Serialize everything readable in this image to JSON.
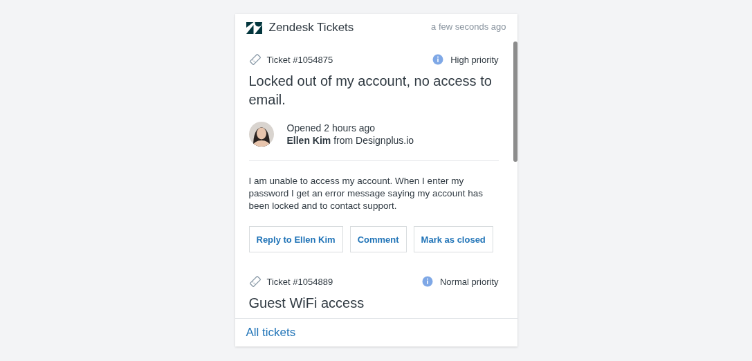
{
  "header": {
    "title": "Zendesk Tickets",
    "timestamp": "a few seconds ago"
  },
  "tickets": [
    {
      "number": "Ticket #1054875",
      "priority": "High priority",
      "title": "Locked out of my account, no access to email.",
      "opened": "Opened 2 hours ago",
      "requester": "**Ellen Kim** from Designplus.io",
      "description": "I am unable to access my account. When I enter my password I get an error message saying my account has been locked and to contact support.",
      "actions": [
        "Reply to Ellen Kim",
        "Comment",
        "Mark as closed"
      ]
    },
    {
      "number": "Ticket #1054889",
      "priority": "Normal priority",
      "title": "Guest WiFi access"
    }
  ],
  "footer": {
    "link": "All tickets"
  }
}
